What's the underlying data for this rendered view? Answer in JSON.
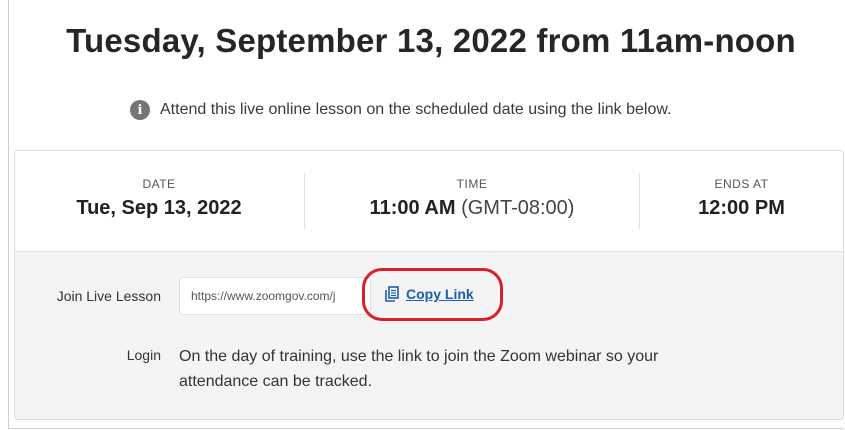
{
  "page": {
    "title": "Tuesday, September 13, 2022 from 11am-noon",
    "notice": "Attend this live online lesson on the scheduled date using the link below.",
    "notice_icon": "info-icon"
  },
  "schedule": {
    "date_label": "DATE",
    "date_value": "Tue, Sep 13, 2022",
    "time_label": "TIME",
    "time_value": "11:00 AM",
    "time_zone": "(GMT-08:00)",
    "ends_label": "ENDS AT",
    "ends_value": "12:00 PM"
  },
  "join": {
    "label": "Join Live Lesson",
    "url": "https://www.zoomgov.com/j",
    "copy_label": "Copy Link",
    "copy_icon": "copy-icon"
  },
  "login": {
    "label": "Login",
    "text": "On the day of training, use the link to join the Zoom webinar so your attendance can be tracked."
  },
  "colors": {
    "link": "#1a5fb4",
    "highlight": "#d92027",
    "panel_bg": "#f4f4f4"
  }
}
